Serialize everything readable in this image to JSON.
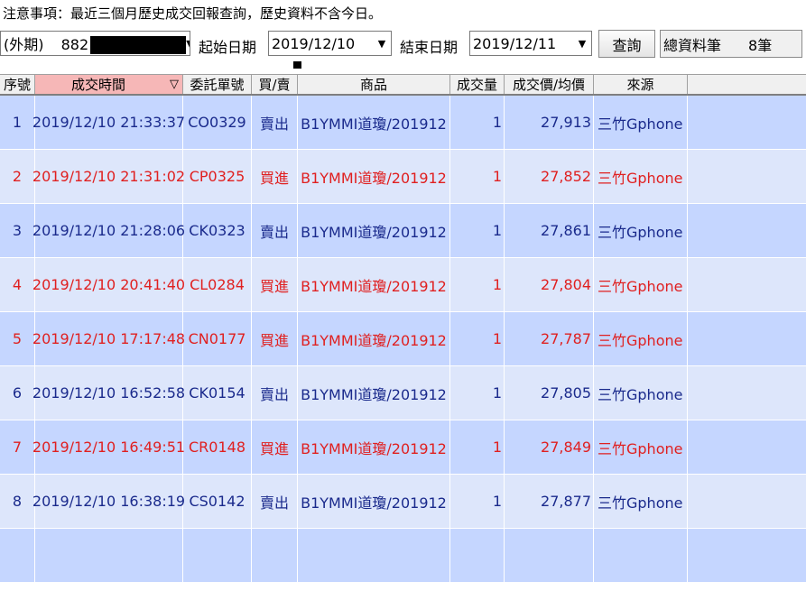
{
  "notice": "注意事項：最近三個月歷史成交回報查詢，歷史資料不含今日。",
  "account": {
    "prefix": "(外期)",
    "number_visible": "882"
  },
  "start_label": "起始日期",
  "start_date": "2019/12/10",
  "end_label": "結束日期",
  "end_date": "2019/12/11",
  "query_label": "查詢",
  "total_label": "總資料筆",
  "total_count": "8筆",
  "columns": [
    "序號",
    "成交時間",
    "委託單號",
    "買/賣",
    "商品",
    "成交量",
    "成交價/均價",
    "來源"
  ],
  "sort_indicator": "▽",
  "rows": [
    {
      "no": "1",
      "time": "2019/12/10 21:33:37",
      "order": "CO0329",
      "side": "賣出",
      "product": "B1YMMI道瓊/201912",
      "qty": "1",
      "price": "27,913",
      "source": "三竹Gphone"
    },
    {
      "no": "2",
      "time": "2019/12/10 21:31:02",
      "order": "CP0325",
      "side": "買進",
      "product": "B1YMMI道瓊/201912",
      "qty": "1",
      "price": "27,852",
      "source": "三竹Gphone"
    },
    {
      "no": "3",
      "time": "2019/12/10 21:28:06",
      "order": "CK0323",
      "side": "賣出",
      "product": "B1YMMI道瓊/201912",
      "qty": "1",
      "price": "27,861",
      "source": "三竹Gphone"
    },
    {
      "no": "4",
      "time": "2019/12/10 20:41:40",
      "order": "CL0284",
      "side": "買進",
      "product": "B1YMMI道瓊/201912",
      "qty": "1",
      "price": "27,804",
      "source": "三竹Gphone"
    },
    {
      "no": "5",
      "time": "2019/12/10 17:17:48",
      "order": "CN0177",
      "side": "買進",
      "product": "B1YMMI道瓊/201912",
      "qty": "1",
      "price": "27,787",
      "source": "三竹Gphone"
    },
    {
      "no": "6",
      "time": "2019/12/10 16:52:58",
      "order": "CK0154",
      "side": "賣出",
      "product": "B1YMMI道瓊/201912",
      "qty": "1",
      "price": "27,805",
      "source": "三竹Gphone"
    },
    {
      "no": "7",
      "time": "2019/12/10 16:49:51",
      "order": "CR0148",
      "side": "買進",
      "product": "B1YMMI道瓊/201912",
      "qty": "1",
      "price": "27,849",
      "source": "三竹Gphone"
    },
    {
      "no": "8",
      "time": "2019/12/10 16:38:19",
      "order": "CS0142",
      "side": "賣出",
      "product": "B1YMMI道瓊/201912",
      "qty": "1",
      "price": "27,877",
      "source": "三竹Gphone"
    }
  ]
}
